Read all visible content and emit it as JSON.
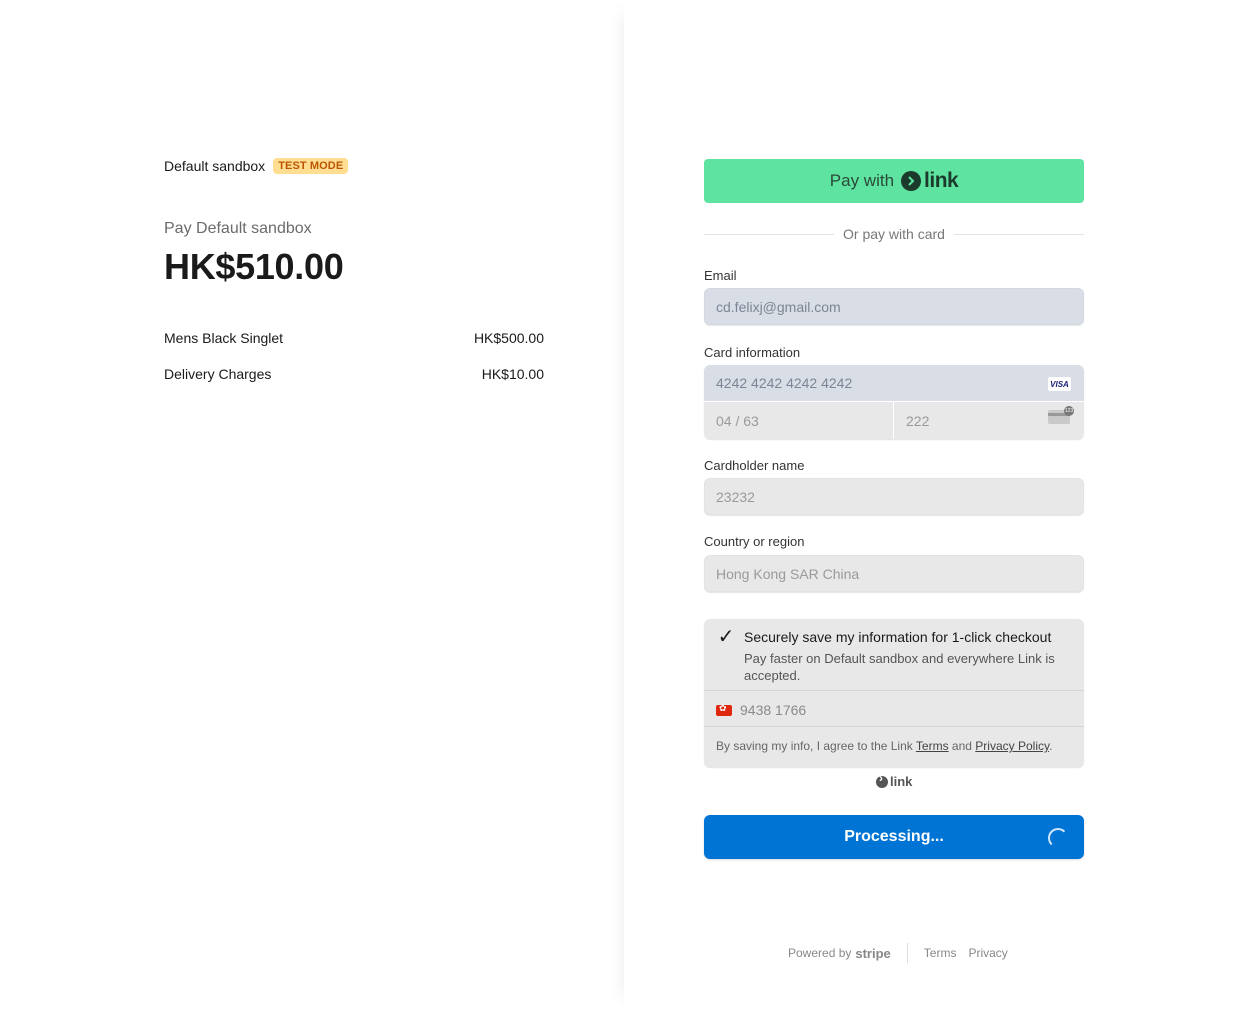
{
  "summary": {
    "merchant_name": "Default sandbox",
    "test_badge": "TEST MODE",
    "pay_label": "Pay Default sandbox",
    "amount": "HK$510.00",
    "line_items": [
      {
        "name": "Mens Black Singlet",
        "price": "HK$500.00"
      },
      {
        "name": "Delivery Charges",
        "price": "HK$10.00"
      }
    ]
  },
  "checkout": {
    "link_button": {
      "prefix": "Pay with",
      "brand": "link"
    },
    "divider_text": "Or pay with card",
    "email": {
      "label": "Email",
      "value": "cd.felixj@gmail.com"
    },
    "card": {
      "label": "Card information",
      "number": "4242 4242 4242 4242",
      "brand": "VISA",
      "expiry": "04 / 63",
      "cvc": "222"
    },
    "cardholder": {
      "label": "Cardholder name",
      "value": "23232"
    },
    "country": {
      "label": "Country or region",
      "value": "Hong Kong SAR China"
    },
    "save_info": {
      "title": "Securely save my information for 1-click checkout",
      "description": "Pay faster on Default sandbox and everywhere Link is accepted.",
      "phone": "9438 1766",
      "legal_prefix": "By saving my info, I agree to the Link",
      "terms": "Terms",
      "and": "and",
      "privacy": "Privacy Policy",
      "period": "."
    },
    "link_small": "link",
    "process_button": "Processing..."
  },
  "footer": {
    "powered_by": "Powered by",
    "brand": "stripe",
    "terms": "Terms",
    "privacy": "Privacy"
  },
  "colors": {
    "link_green": "#5ee4a0",
    "primary_blue": "#0074d4",
    "test_badge_bg": "#ffde92"
  }
}
